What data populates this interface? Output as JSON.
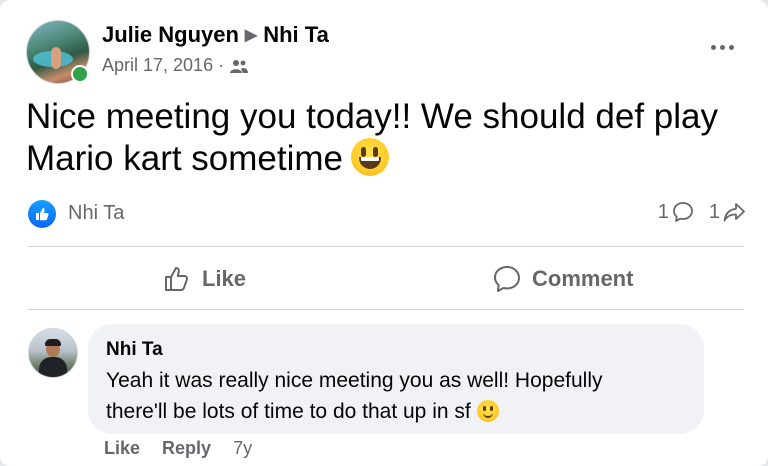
{
  "post": {
    "author": "Julie Nguyen",
    "recipient": "Nhi Ta",
    "date": "April 17, 2016",
    "date_separator": "·",
    "audience_icon": "friends-icon",
    "more_icon": "more-options-icon",
    "text_line1": "Nice meeting you today!! We should def play",
    "text_line2": "Mario kart sometime",
    "emoji": "grinning-face-emoji"
  },
  "reactions": {
    "reactor": "Nhi Ta",
    "comment_count": "1",
    "share_count": "1"
  },
  "actions": {
    "like_label": "Like",
    "comment_label": "Comment"
  },
  "comment": {
    "author": "Nhi Ta",
    "text_line1": "Yeah it was really nice meeting you as well! Hopefully",
    "text_line2": "there'll be lots of time to do that up in sf",
    "emoji": "slightly-smiling-face-emoji",
    "like_label": "Like",
    "reply_label": "Reply",
    "timestamp": "7y"
  },
  "colors": {
    "accent": "#0866ff",
    "online": "#31a24c",
    "secondary_text": "#65676b",
    "bubble": "#f0f2f5"
  }
}
